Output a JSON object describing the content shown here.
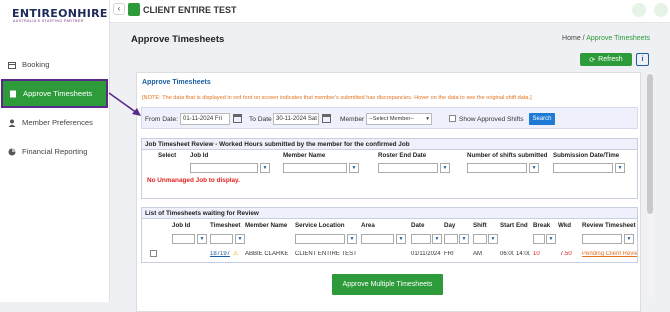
{
  "brand": {
    "logo": "ENTIREONHIRE",
    "tagline": "AUSTRALIA'S STAFFING PARTNER"
  },
  "sidebar": {
    "items": [
      {
        "label": "Booking"
      },
      {
        "label": "Approve Timesheets"
      },
      {
        "label": "Member Preferences"
      },
      {
        "label": "Financial Reporting"
      }
    ]
  },
  "header": {
    "back": "‹",
    "client": "CLIENT ENTIRE TEST"
  },
  "page": {
    "title": "Approve Timesheets",
    "crumb_home": "Home",
    "crumb_sep": " / ",
    "crumb_current": "Approve Timesheets",
    "refresh": "Refresh",
    "info": "i"
  },
  "card": {
    "title": "Approve Timesheets",
    "note": "[NOTE: The data that is displayed in red font on screen indicates that member's submitted has discrepancies. Hover on the data to see the original shift data.]"
  },
  "filter": {
    "from_label": "From Date:",
    "from_value": "01-11-2024 Fri",
    "to_label": "To Date",
    "to_value": "30-11-2024 Sat",
    "member_label": "Member",
    "member_value": "--Select Member--",
    "approved_label": "Show Approved Shifts",
    "search": "Search"
  },
  "review": {
    "title": "Job Timesheet Review - Worked Hours submitted by the member for the confirmed Job",
    "columns": [
      "Select",
      "Job Id",
      "Member Name",
      "Roster End Date",
      "Number of shifts submitted",
      "Submission Date/Time"
    ],
    "empty": "No Unmanaged Job to display."
  },
  "list": {
    "title": "List of Timesheets waiting for Review",
    "columns": [
      "Job Id",
      "Timesheet",
      "Member Name",
      "Service Location",
      "Area",
      "Date",
      "Day",
      "Shift",
      "Start",
      "End",
      "Break",
      "Wkd Hrs",
      "Review Timesheet"
    ],
    "rows": [
      {
        "timesheet": "187197",
        "warn": "⚠",
        "member": "ABBIE CLARKE",
        "location": "CLIENT ENTIRE TEST",
        "area": "",
        "date": "01/11/2024",
        "day": "FRI",
        "shift": "AM",
        "start": "06:00",
        "end": "14:00",
        "break": "10",
        "hours": "7.50",
        "review": "Pending Client Review"
      }
    ]
  },
  "approve_multiple": "Approve Multiple Timesheets"
}
